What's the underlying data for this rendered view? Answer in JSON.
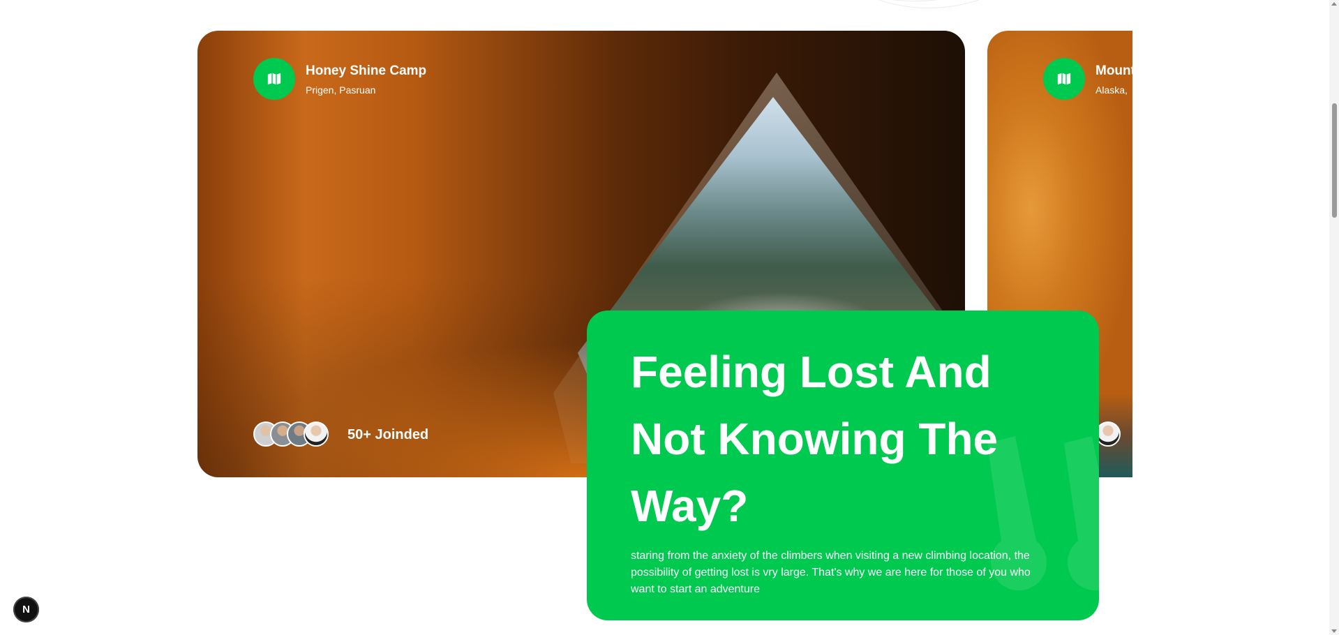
{
  "cards": [
    {
      "title": "Honey Shine Camp",
      "location": "Prigen, Pasruan",
      "joined": "50+ Joinded",
      "icon": "map-icon"
    },
    {
      "title": "Mount",
      "location": "Alaska,",
      "icon": "map-icon"
    }
  ],
  "feature": {
    "title": "Feeling Lost And Not Knowing The Way?",
    "description": "staring from the anxiety of the climbers when visiting a new climbing location, the possibility of getting lost is vry large. That's why we are here for those of you who want to start an adventure"
  },
  "dev_indicator": {
    "label": "N"
  },
  "colors": {
    "accent": "#00c94f",
    "background": "#ffffff",
    "text_light": "#ffffff"
  }
}
